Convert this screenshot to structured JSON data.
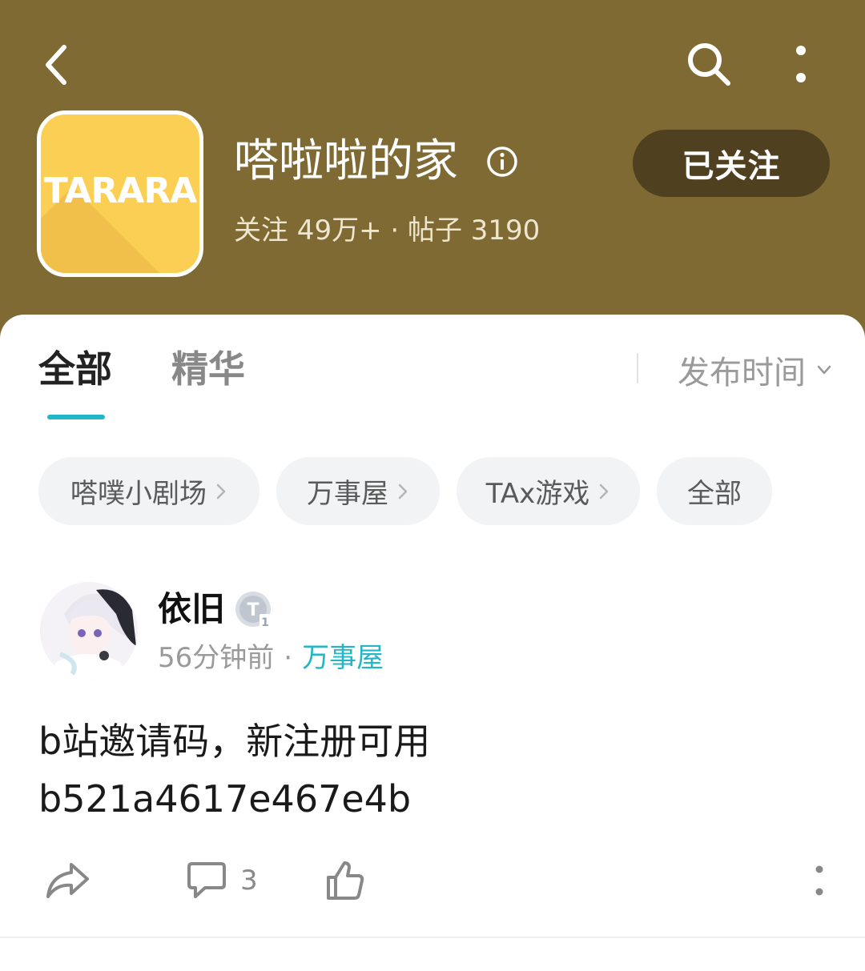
{
  "header": {
    "forum_name": "嗒啦啦的家",
    "logo_text": "TARARA",
    "stats": "关注 49万+ · 帖子 3190",
    "follow_label": "已关注"
  },
  "tabs": [
    {
      "label": "全部",
      "active": true
    },
    {
      "label": "精华",
      "active": false
    }
  ],
  "sort": {
    "label": "发布时间"
  },
  "chips": [
    {
      "label": "嗒噗小剧场",
      "has_arrow": true
    },
    {
      "label": "万事屋",
      "has_arrow": true
    },
    {
      "label": "TAx游戏",
      "has_arrow": true
    },
    {
      "label": "全部",
      "has_arrow": false
    }
  ],
  "post": {
    "author": "依旧",
    "time": "56分钟前",
    "separator": "·",
    "category": "万事屋",
    "body_line1": "b站邀请码，新注册可用",
    "body_line2": "b521a4617e467e4b",
    "comment_count": "3"
  },
  "colors": {
    "header_bg": "#7f6a33",
    "follow_bg": "#4f4020",
    "accent": "#22b7c6",
    "logo_bg": "#fbcf53"
  },
  "icons": [
    "back-arrow-icon",
    "search-icon",
    "more-vertical-icon",
    "info-icon",
    "chevron-down-icon",
    "share-icon",
    "comment-icon",
    "thumbs-up-icon",
    "level-badge-icon"
  ]
}
